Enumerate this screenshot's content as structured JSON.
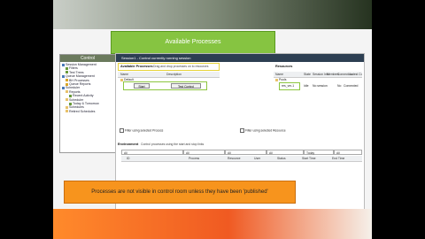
{
  "slide": {
    "callout_top": "Available Processes",
    "callout_bottom": "Processes are not visible in control room unless they have been 'published'"
  },
  "left_panel": {
    "title": "Control",
    "items": [
      "Session Management",
      "Filters",
      "Test Trees",
      "Queue Management",
      "BH Processes",
      "Queue Reports",
      "Scheduler",
      "Reports",
      "Recent Activity",
      "Scheduler",
      "Today & Tomorrow",
      "Schedules",
      "Retired Schedules"
    ]
  },
  "main": {
    "session_bar": "Session1 - Control currently running session",
    "available_processes_label": "Available Processes",
    "available_processes_hint": "Drag and drop processes on to resources",
    "resources_label": "Resources",
    "proc_cols": [
      "Name",
      "Description"
    ],
    "proc_tree_root": "Default",
    "proc_rows": [
      {
        "name": "Start",
        "description": "Test Control"
      }
    ],
    "res_cols": [
      "Name",
      "State",
      "Session Info",
      "Members",
      "Connection",
      "Latest Connection Message"
    ],
    "res_tree_root": "Pools",
    "res_rows": [
      {
        "name": "res_vm-1",
        "state": "Idle",
        "info": "No session",
        "members": "",
        "connection": "No",
        "message": "Connected"
      }
    ],
    "filter_processes": "Filter using selected Process",
    "filter_resources": "Filter using selected Resource",
    "environment_label": "Environment",
    "environment_hint": "Control processes using the start and stop links",
    "filter_values": [
      "All",
      "All",
      "All",
      "All",
      "Today",
      "All"
    ],
    "session_cols": [
      "ID",
      "Process",
      "Resource",
      "User",
      "Status",
      "Start Time",
      "End Time"
    ]
  }
}
